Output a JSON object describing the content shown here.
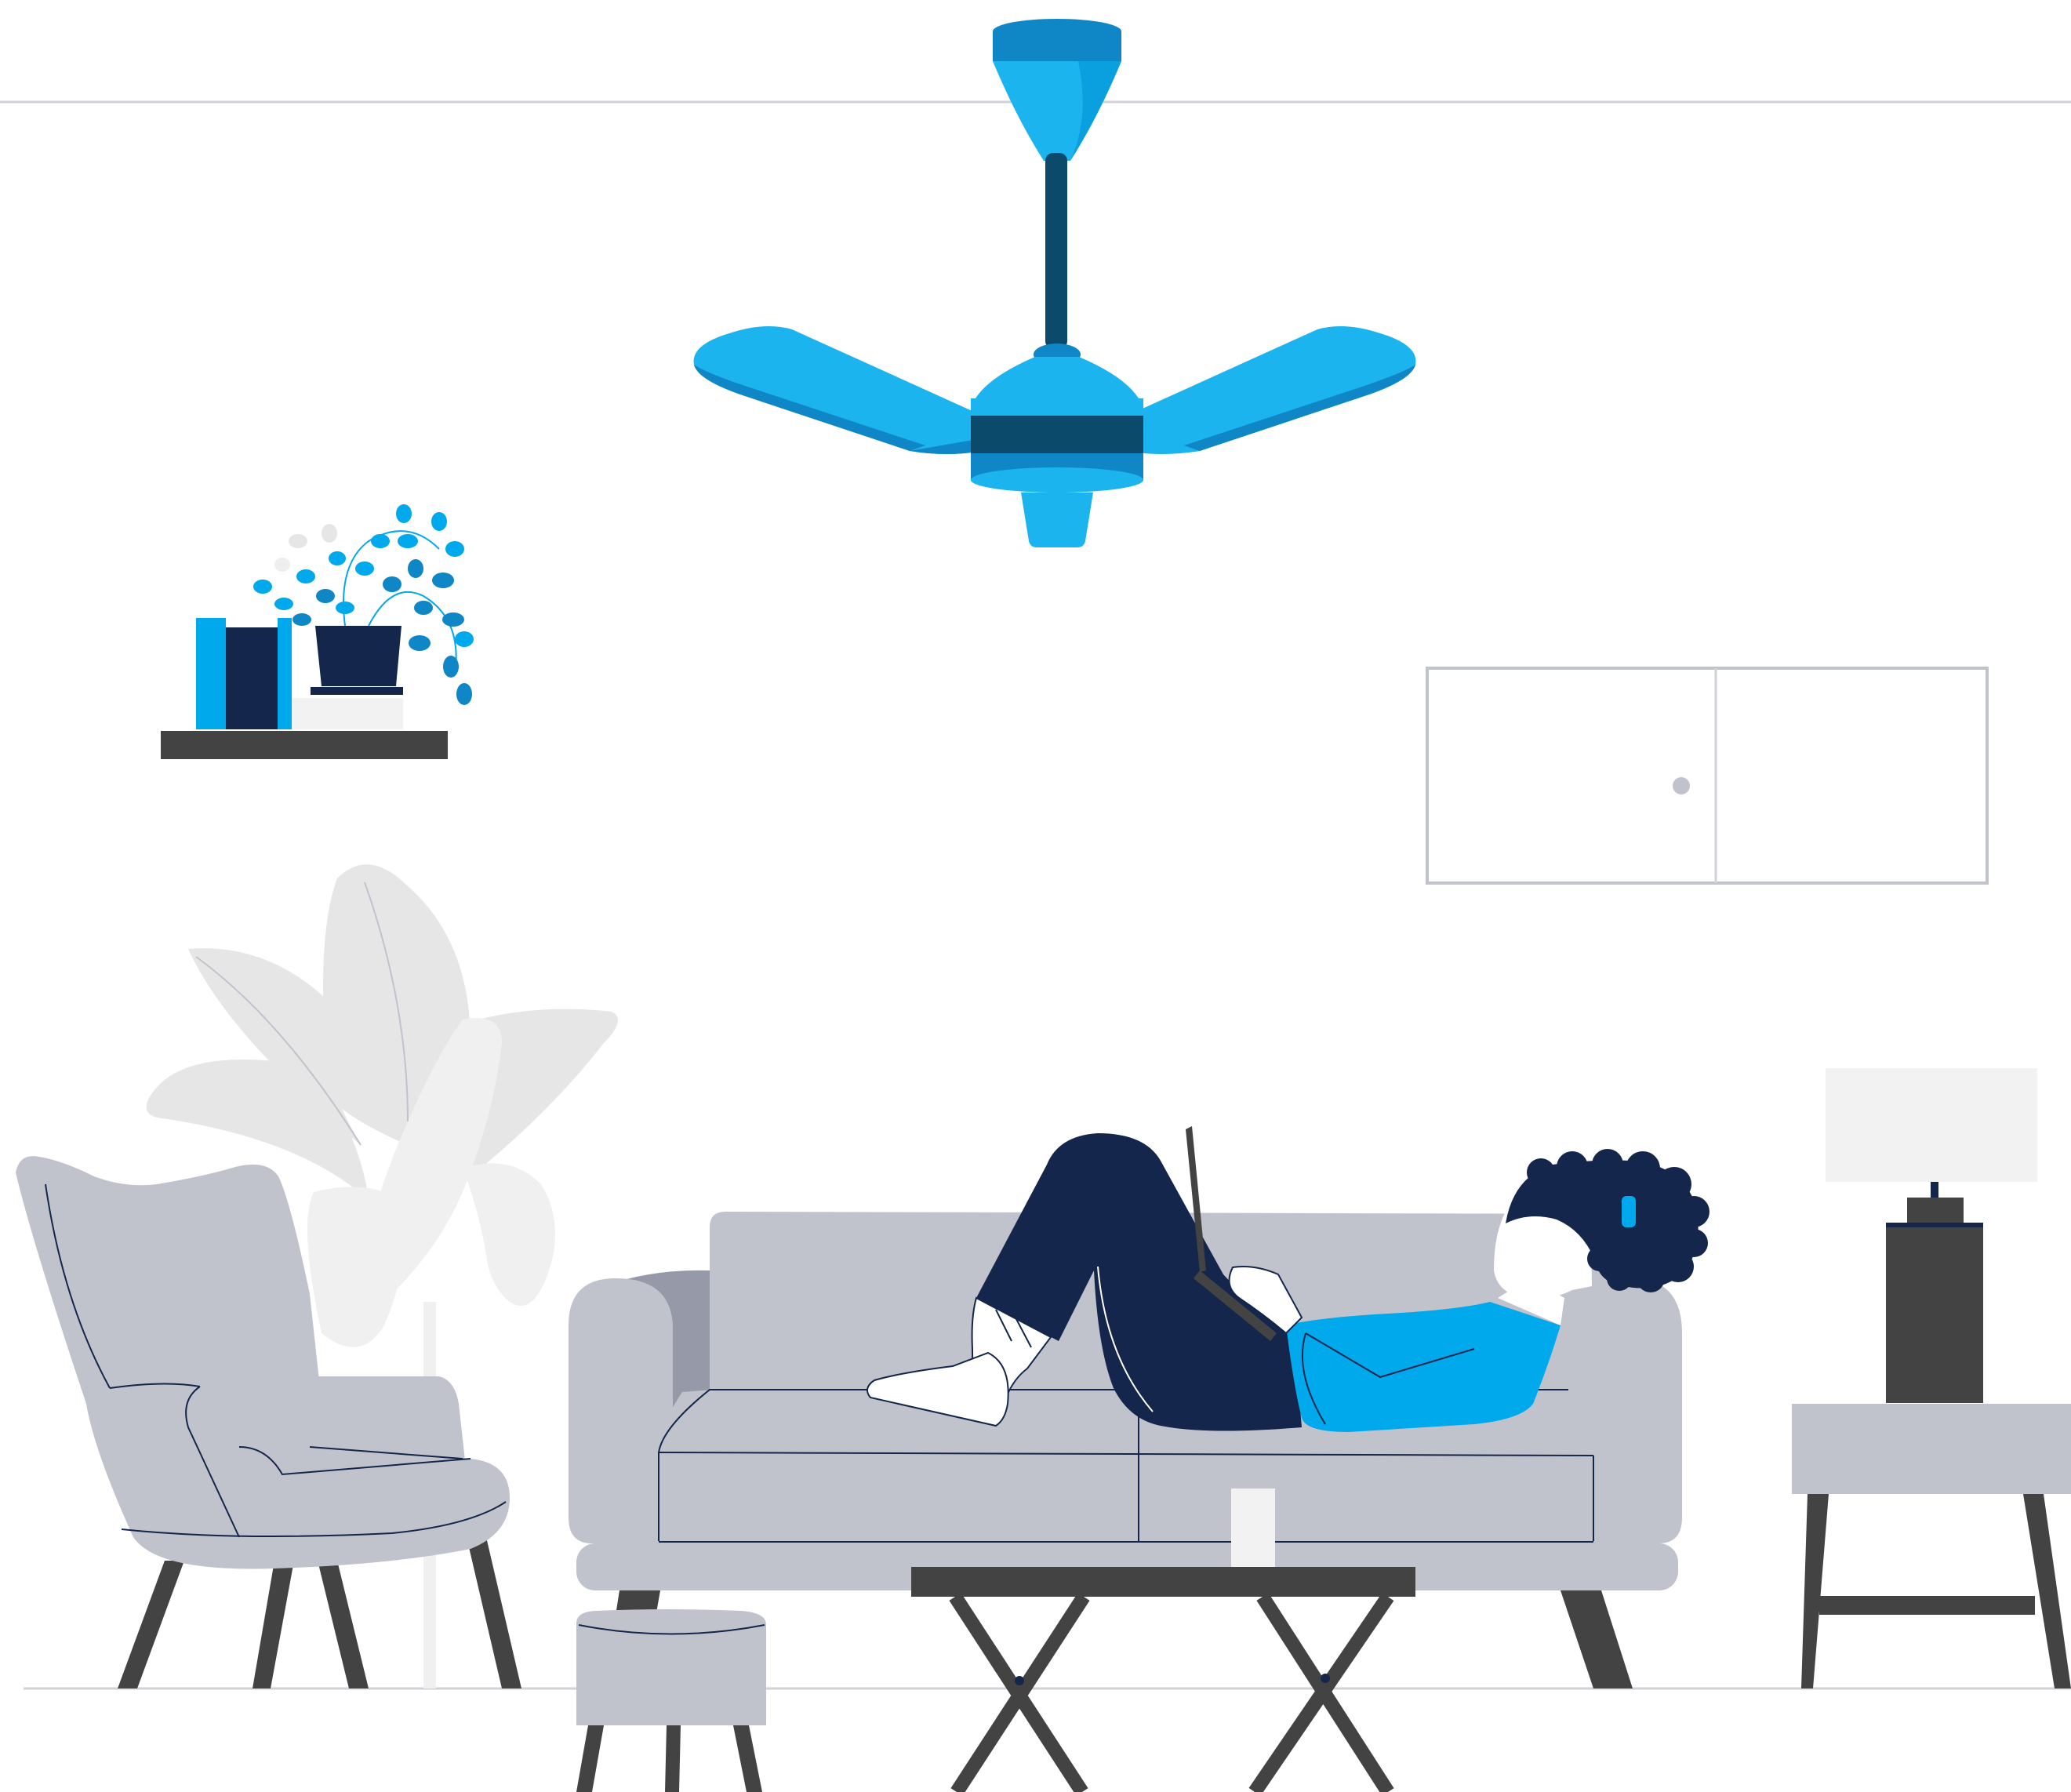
{
  "scene": {
    "subject": "person-lying-on-sofa-with-laptop",
    "colors": {
      "background": "#ffffff",
      "line": "#d0d2d8",
      "furniture_gray": "#c1c3cc",
      "furniture_shadow": "#9699a8",
      "dark_gray": "#434343",
      "navy": "#14264b",
      "blue": "#00a8ec",
      "fan_blue": "#1cb4ef",
      "fan_dark": "#0b4a6a",
      "fan_mid": "#0f86c6",
      "plant_light": "#e6e6e6",
      "plant_lighter": "#f0f0f0",
      "skin": "#ffffff"
    }
  }
}
